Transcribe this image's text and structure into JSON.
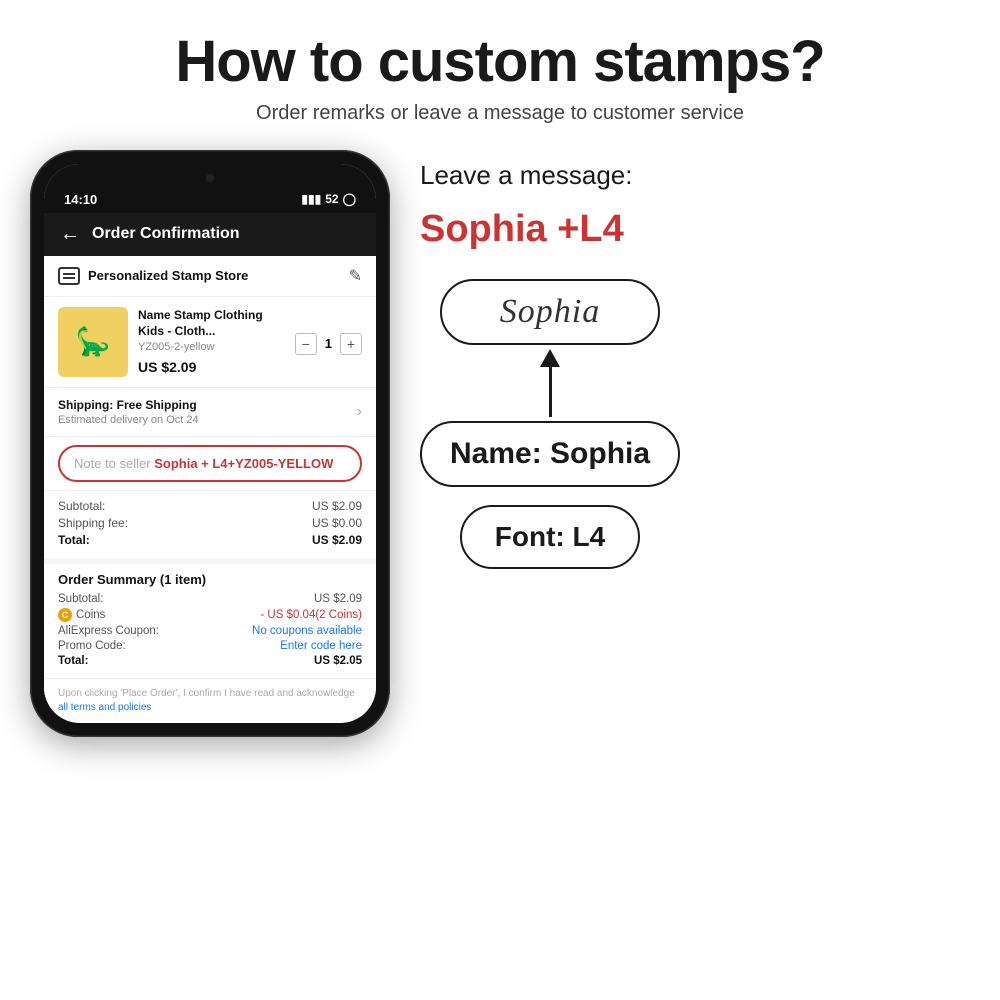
{
  "header": {
    "title": "How to custom stamps?",
    "subtitle": "Order remarks or leave a message to customer service"
  },
  "phone": {
    "status_time": "14:10",
    "status_signal": "52",
    "nav_title": "Order Confirmation",
    "store_name": "Personalized Stamp Store",
    "product_name": "Name Stamp Clothing Kids - Cloth...",
    "product_sku": "YZ005-2-yellow",
    "product_price": "US $2.09",
    "product_qty": "1",
    "shipping_title": "Shipping: Free Shipping",
    "shipping_sub": "Estimated delivery on Oct 24",
    "note_placeholder": "Note to seller",
    "note_highlight": "Sophia + L4+YZ005-YELLOW",
    "subtotal_label": "Subtotal:",
    "subtotal_value": "US $2.09",
    "shipping_fee_label": "Shipping fee:",
    "shipping_fee_value": "US $0.00",
    "total_label": "Total:",
    "total_value": "US $2.09",
    "order_summary_title": "Order Summary (1 item)",
    "os_subtotal_label": "Subtotal:",
    "os_subtotal_value": "US $2.09",
    "coins_label": "Coins",
    "coins_value": "- US $0.04(2 Coins)",
    "coupon_label": "AliExpress Coupon:",
    "coupon_value": "No coupons available",
    "promo_label": "Promo Code:",
    "promo_value": "Enter code here",
    "os_total_label": "Total:",
    "os_total_value": "US $2.05",
    "footer_text": "Upon clicking 'Place Order', I confirm I have read and acknowledge",
    "footer_link": "all terms and policies"
  },
  "right_panel": {
    "leave_message_label": "Leave a message:",
    "message_value": "Sophia +L4",
    "stamp_text": "Sophia",
    "name_label": "Name: Sophia",
    "font_label": "Font: L4"
  }
}
